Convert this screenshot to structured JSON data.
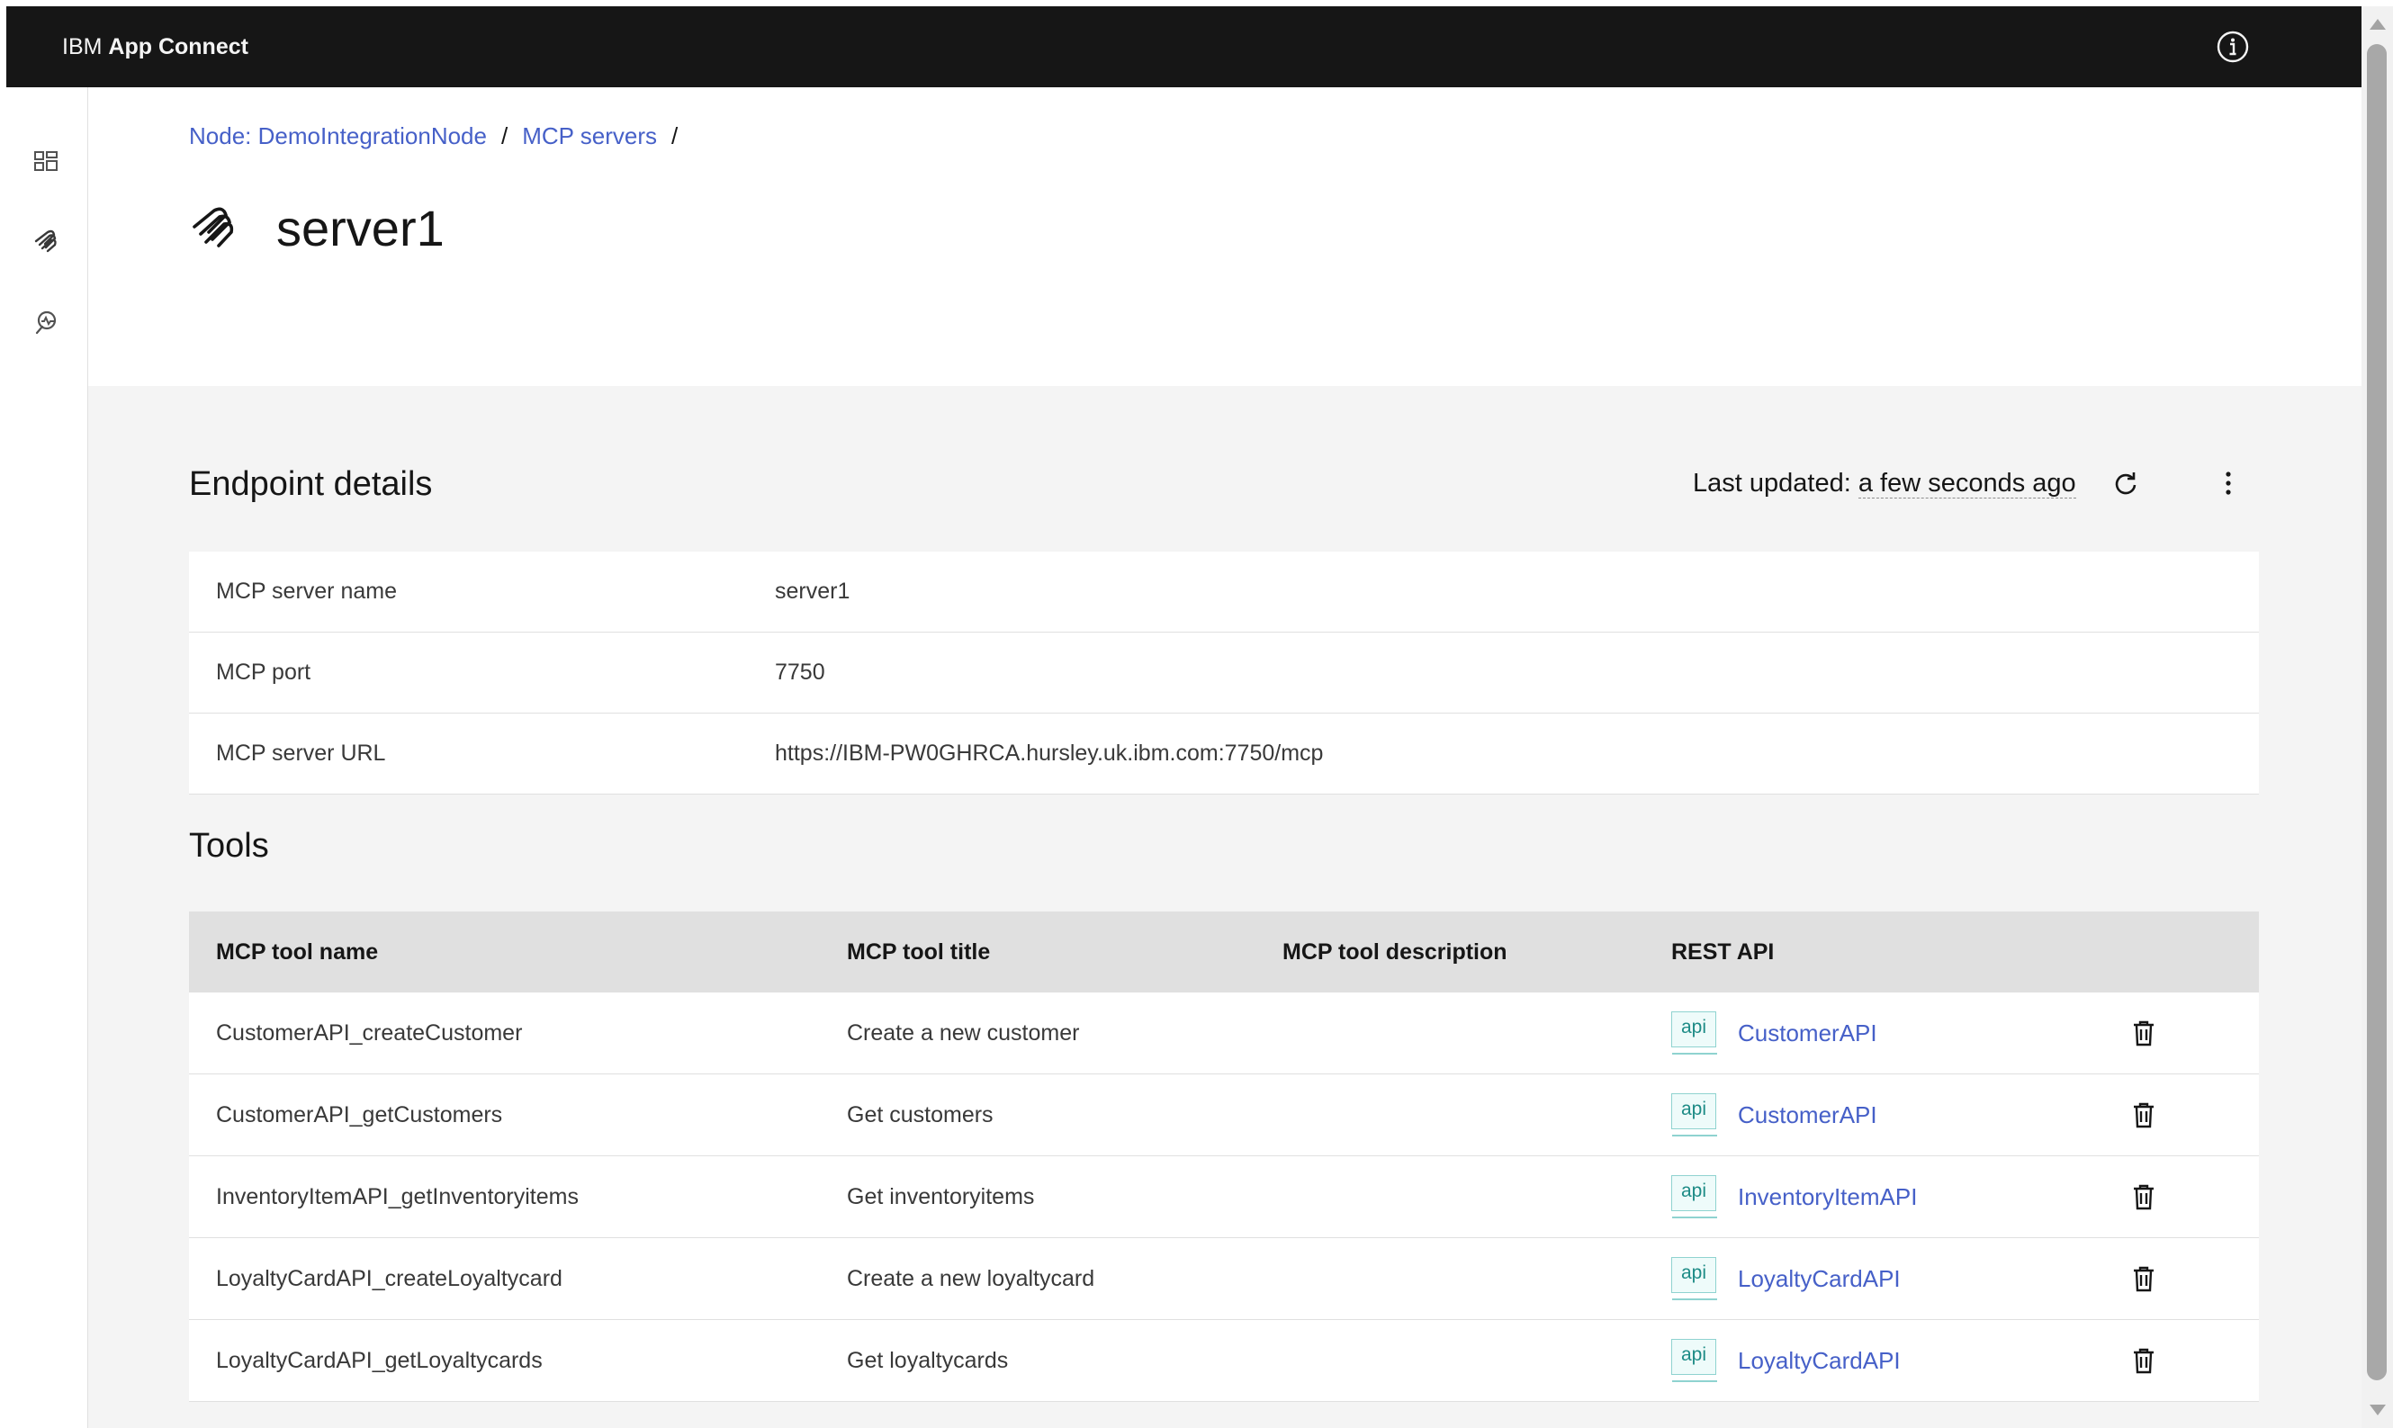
{
  "app": {
    "brand_prefix": "IBM",
    "brand_name": "App Connect"
  },
  "topbar": {
    "info_icon": "information-icon"
  },
  "sidenav": {
    "items": [
      {
        "name": "dashboard",
        "icon": "dashboard-icon"
      },
      {
        "name": "mcp-servers",
        "icon": "mcp-server-icon"
      },
      {
        "name": "monitoring",
        "icon": "activity-monitor-icon"
      }
    ]
  },
  "breadcrumb": {
    "items": [
      "Node: DemoIntegrationNode",
      "MCP servers"
    ],
    "separator": "/"
  },
  "page": {
    "title": "server1",
    "icon": "mcp-server-icon"
  },
  "endpoint": {
    "title": "Endpoint details",
    "last_updated_label": "Last updated:",
    "last_updated_value": "a few seconds ago",
    "refresh_icon": "refresh-icon",
    "overflow_icon": "overflow-menu-icon",
    "rows": [
      {
        "label": "MCP server name",
        "value": "server1"
      },
      {
        "label": "MCP port",
        "value": "7750"
      },
      {
        "label": "MCP server URL",
        "value": "https://IBM-PW0GHRCA.hursley.uk.ibm.com:7750/mcp"
      }
    ]
  },
  "tools": {
    "title": "Tools",
    "columns": [
      "MCP tool name",
      "MCP tool title",
      "MCP tool description",
      "REST API"
    ],
    "rows": [
      {
        "name": "CustomerAPI_createCustomer",
        "title": "Create a new customer",
        "description": "",
        "api_tag": "api",
        "api": "CustomerAPI"
      },
      {
        "name": "CustomerAPI_getCustomers",
        "title": "Get customers",
        "description": "",
        "api_tag": "api",
        "api": "CustomerAPI"
      },
      {
        "name": "InventoryItemAPI_getInventoryitems",
        "title": "Get inventoryitems",
        "description": "",
        "api_tag": "api",
        "api": "InventoryItemAPI"
      },
      {
        "name": "LoyaltyCardAPI_createLoyaltycard",
        "title": "Create a new loyaltycard",
        "description": "",
        "api_tag": "api",
        "api": "LoyaltyCardAPI"
      },
      {
        "name": "LoyaltyCardAPI_getLoyaltycards",
        "title": "Get loyaltycards",
        "description": "",
        "api_tag": "api",
        "api": "LoyaltyCardAPI"
      }
    ],
    "delete_icon": "trash-can-icon"
  },
  "colors": {
    "topbar": "#161616",
    "link": "#4660c8",
    "content_bg": "#f4f4f4",
    "table_header": "#e0e0e0",
    "api_tag": "#1d8b86"
  }
}
